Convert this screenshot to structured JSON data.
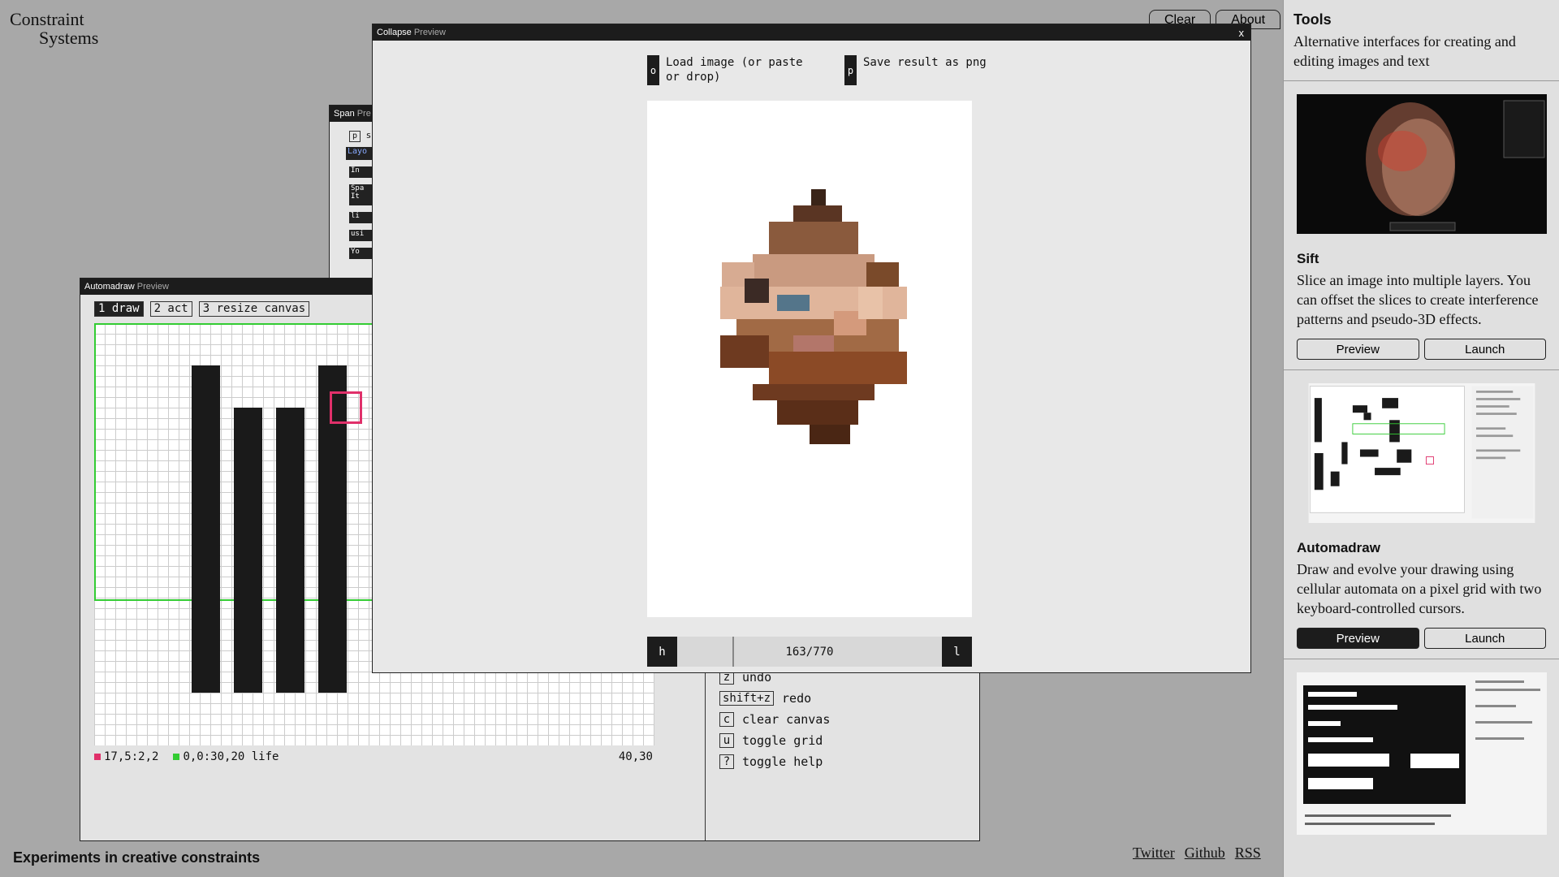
{
  "brand": {
    "line1": "Constraint",
    "line2": "Systems"
  },
  "top_buttons": {
    "clear": "Clear",
    "about": "About"
  },
  "tagline": "Experiments in creative constraints",
  "footer_links": [
    "Twitter",
    "Github",
    "RSS"
  ],
  "span_window": {
    "title": "Span",
    "subtitle": "Pre",
    "key": "p",
    "key_suffix": "s",
    "layout_label": "Layo",
    "lines": [
      "In",
      "Spa It",
      "li",
      "usi",
      "Yo"
    ]
  },
  "automadraw": {
    "title": "Automadraw",
    "subtitle": "Preview",
    "tabs": [
      "1 draw",
      "2 act",
      "3 resize canvas"
    ],
    "status_left": "17,5:2,2",
    "status_mid": "0,0:30,20 life",
    "status_right": "40,30",
    "help": [
      {
        "key": "z",
        "label": "undo"
      },
      {
        "key": "shift+z",
        "label": "redo"
      },
      {
        "key": "c",
        "label": "clear canvas"
      },
      {
        "key": "u",
        "label": "toggle grid"
      },
      {
        "key": "?",
        "label": "toggle help"
      }
    ]
  },
  "collapse": {
    "title": "Collapse",
    "subtitle": "Preview",
    "close": "x",
    "load_key": "o",
    "load_label": "Load image (or paste or drop)",
    "save_key": "p",
    "save_label": "Save result as png",
    "prev_key": "h",
    "next_key": "l",
    "progress": "163/770"
  },
  "sidebar": {
    "title": "Tools",
    "description": "Alternative interfaces for creating and editing images and text",
    "tools": [
      {
        "name": "Sift",
        "description": "Slice an image into multiple layers. You can offset the slices to create interference patterns and pseudo-3D effects.",
        "preview": "Preview",
        "launch": "Launch"
      },
      {
        "name": "Automadraw",
        "description": "Draw and evolve your drawing using cellular automata on a pixel grid with two keyboard-controlled cursors.",
        "preview": "Preview",
        "launch": "Launch"
      }
    ]
  },
  "colors": {
    "accent_pink": "#e0306a",
    "accent_green": "#33cc33",
    "window_bar": "#1c1c1c"
  }
}
